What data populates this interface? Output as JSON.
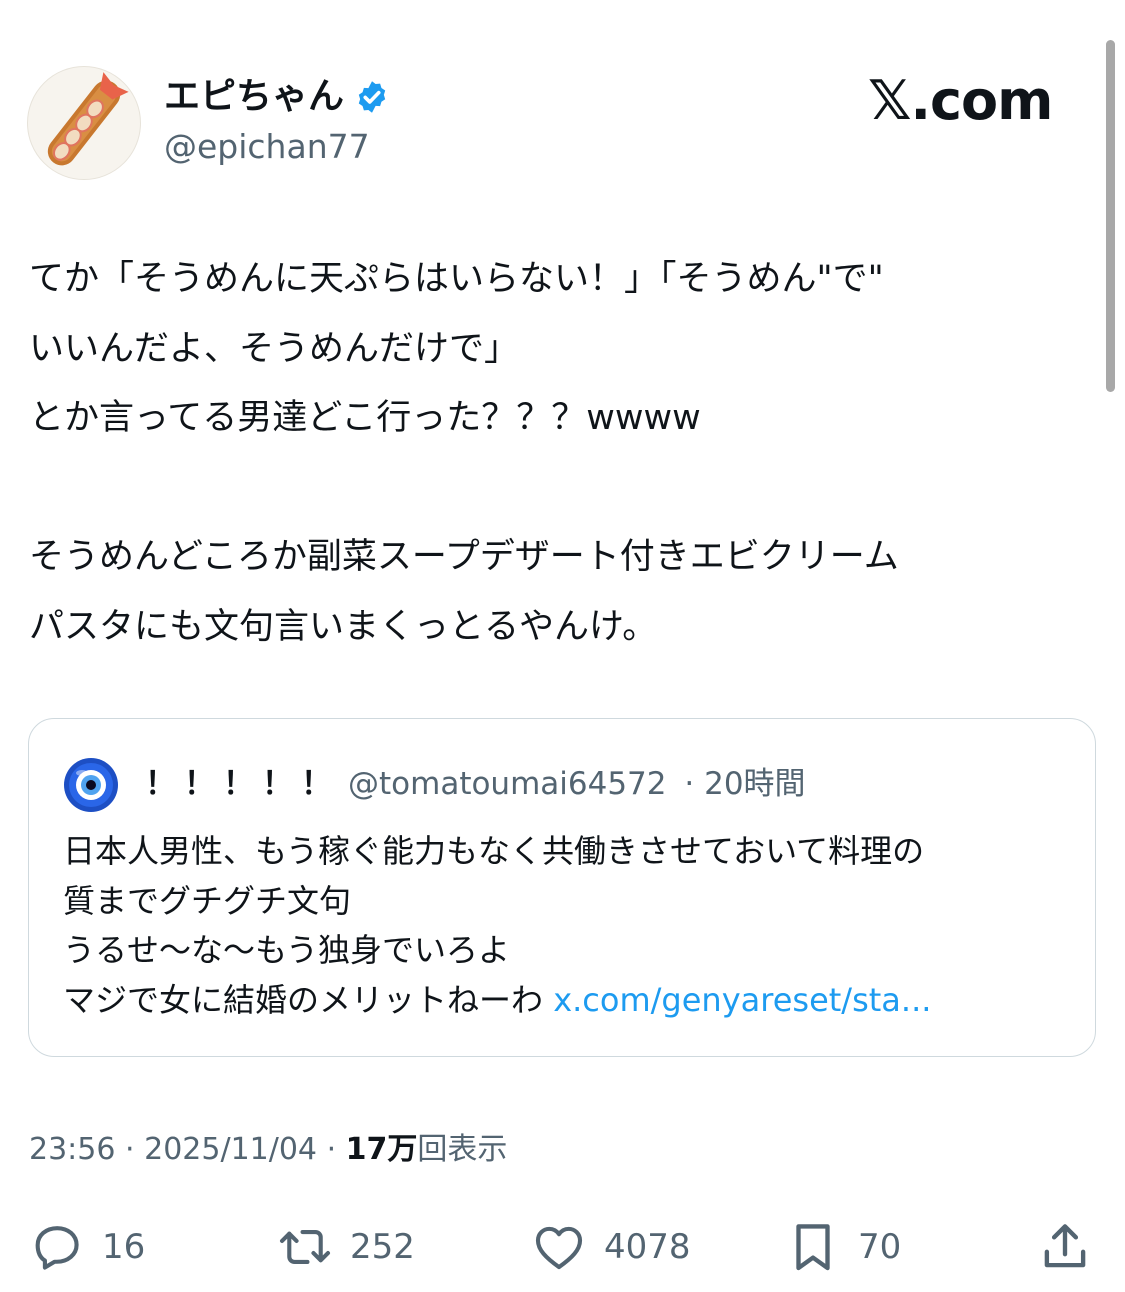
{
  "author": {
    "display_name": "エピちゃん",
    "handle": "@epichan77"
  },
  "site_logo": "𝕏.com",
  "tweet": {
    "lines": [
      "てか「そうめんに天ぷらはいらない！」「そうめん\"で\"",
      "いいんだよ、そうめんだけで」",
      "とか言ってる男達どこ行った？？？wwww",
      "",
      "そうめんどころか副菜スープデザート付きエビクリーム",
      "パスタにも文句言いまくっとるやんけ。"
    ]
  },
  "quote": {
    "name": "！！！！！",
    "handle": "@tomatoumai64572",
    "separator": "·",
    "time": "20時間",
    "lines": [
      "日本人男性、もう稼ぐ能力もなく共働きさせておいて料理の",
      "質までグチグチ文句",
      "うるせ〜な〜もう独身でいろよ"
    ],
    "last_line": "マジで女に結婚のメリットねーわ",
    "link": "x.com/genyareset/sta..."
  },
  "meta": {
    "time": "23:56",
    "date": "2025/11/04",
    "separator": "·",
    "views_count": "17万",
    "views_label": "回表示"
  },
  "actions": {
    "replies": "16",
    "reposts": "252",
    "likes": "4078",
    "bookmarks": "70"
  },
  "colors": {
    "verified": "#1d9bf0",
    "link": "#1d9bf0",
    "secondary_text": "#536471",
    "border": "#cfd9de"
  },
  "icons": [
    "ebi-fry-avatar",
    "verified-badge-icon",
    "nazar-eye-avatar",
    "reply-icon",
    "repost-icon",
    "like-icon",
    "bookmark-icon",
    "share-icon"
  ]
}
